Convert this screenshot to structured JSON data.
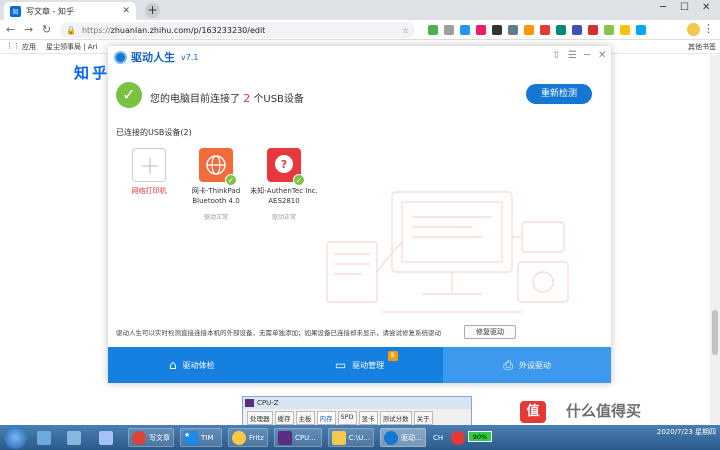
{
  "browser": {
    "tab_title": "写文章 - 知乎",
    "tab_favicon": "知",
    "new_tab": "+",
    "url": "zhuanlan.zhihu.com/p/163233230/edit",
    "url_prefix": "https://",
    "bookmarks": [
      "应用",
      "星尘领事局 | Ari"
    ],
    "bookmarks_right": "其他书签"
  },
  "page": {
    "logo": "知乎"
  },
  "driver_app": {
    "name": "驱动人生",
    "version": "v7.1",
    "status_prefix": "您的电脑目前连接了",
    "status_count": "2",
    "status_suffix": "个USB设备",
    "redetect_label": "重新检测",
    "connected_label": "已连接的USB设备(2)",
    "devices": [
      {
        "name": "网络打印机",
        "status": "",
        "icon": "plus-icon",
        "color": "#e53935"
      },
      {
        "name": "网卡-ThinkPad Bluetooth 4.0",
        "status": "驱动正常",
        "icon": "globe-icon",
        "color": "#f26b3a"
      },
      {
        "name": "未知-AuthenTec Inc. AES2810",
        "status": "驱动正常",
        "icon": "question-icon",
        "color": "#e8383d"
      }
    ],
    "footer_note": "驱动人生可以实时检测直接连接本机的外部设备，无需单独添加；如果设备已连接却未显示，请尝试修复系统驱动",
    "repair_label": "修复驱动",
    "nav": [
      {
        "label": "驱动体检",
        "icon": "home-icon",
        "active": false
      },
      {
        "label": "驱动管理",
        "icon": "monitor-icon",
        "active": false,
        "badge": "8"
      },
      {
        "label": "外设驱动",
        "icon": "printer-icon",
        "active": true
      }
    ],
    "accent": "#1680e0"
  },
  "cpuz": {
    "title": "CPU-Z",
    "tabs": [
      "处理器",
      "缓存",
      "主板",
      "内存",
      "SPD",
      "显卡",
      "测试分数",
      "关于"
    ],
    "active_tab": "内存"
  },
  "taskbar": {
    "items": [
      "写文章",
      "TIM",
      "Fritz",
      "CPU...",
      "C:\\U...",
      "驱动..."
    ],
    "tray_input": "CH",
    "battery": "90%",
    "time": "",
    "date": "2020/7/23 星期四"
  },
  "watermark": {
    "text": "什么值得买",
    "badge": "值"
  }
}
